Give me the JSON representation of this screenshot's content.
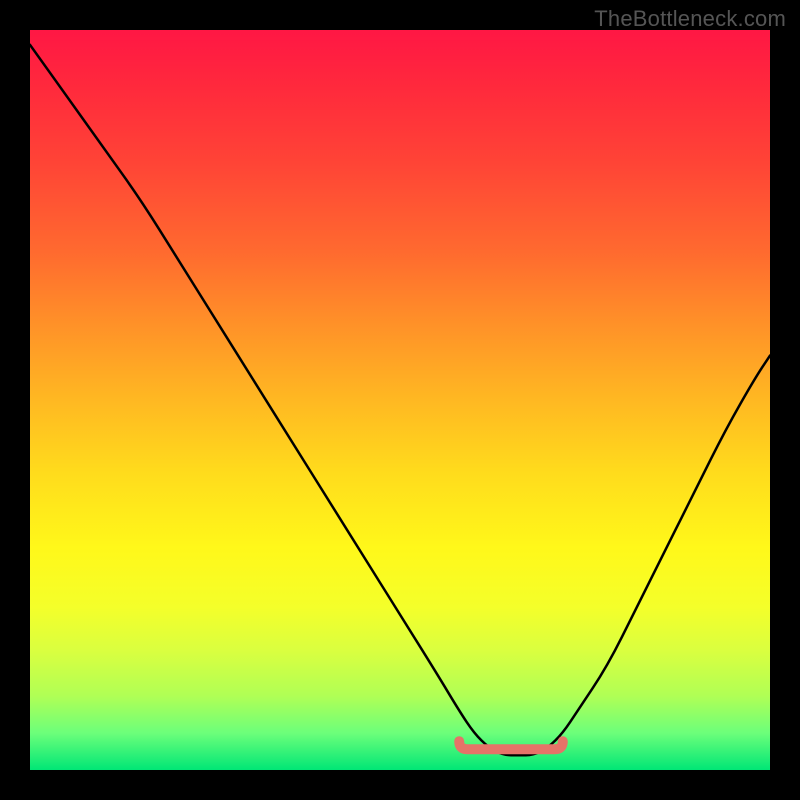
{
  "attribution": "TheBottleneck.com",
  "colors": {
    "curve": "#000000",
    "highlight": "#e57368",
    "gradient_top": "#ff1744",
    "gradient_bottom": "#00e676",
    "background": "#000000"
  },
  "chart_data": {
    "type": "line",
    "title": "",
    "xlabel": "",
    "ylabel": "",
    "xlim": [
      0,
      100
    ],
    "ylim": [
      0,
      100
    ],
    "x": [
      0,
      5,
      10,
      15,
      20,
      25,
      30,
      35,
      40,
      45,
      50,
      55,
      58,
      60,
      62,
      64,
      66,
      68,
      70,
      72,
      74,
      78,
      82,
      86,
      90,
      94,
      98,
      100
    ],
    "series": [
      {
        "name": "bottleneck-curve",
        "values": [
          98,
          91,
          84,
          77,
          69,
          61,
          53,
          45,
          37,
          29,
          21,
          13,
          8,
          5,
          3,
          2,
          2,
          2,
          3,
          5,
          8,
          14,
          22,
          30,
          38,
          46,
          53,
          56
        ]
      }
    ],
    "optimal_zone": {
      "x_start": 58,
      "x_end": 72,
      "y": 2
    },
    "grid": false,
    "legend": false
  }
}
